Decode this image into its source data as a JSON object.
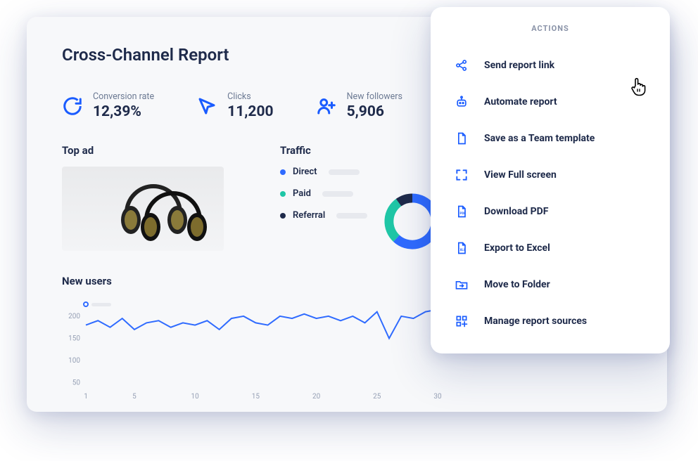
{
  "title": "Cross-Channel Report",
  "stats": {
    "conversion": {
      "label": "Conversion rate",
      "value": "12,39%"
    },
    "clicks": {
      "label": "Clicks",
      "value": "11,200"
    },
    "followers": {
      "label": "New followers",
      "value": "5,906"
    }
  },
  "top_ad": {
    "heading": "Top ad"
  },
  "traffic": {
    "heading": "Traffic",
    "items": [
      {
        "label": "Direct",
        "color": "#2f6bff"
      },
      {
        "label": "Paid",
        "color": "#1fc6a6"
      },
      {
        "label": "Referral",
        "color": "#1e2a4a"
      }
    ]
  },
  "new_users": {
    "heading": "New users"
  },
  "chart_data": {
    "type": "line",
    "title": "New users",
    "x": [
      1,
      2,
      3,
      4,
      5,
      6,
      7,
      8,
      9,
      10,
      11,
      12,
      13,
      14,
      15,
      16,
      17,
      18,
      19,
      20,
      21,
      22,
      23,
      24,
      25,
      26,
      27,
      28,
      29,
      30
    ],
    "values": [
      180,
      190,
      175,
      195,
      170,
      185,
      190,
      175,
      185,
      180,
      190,
      170,
      195,
      200,
      185,
      180,
      200,
      195,
      205,
      195,
      200,
      190,
      200,
      185,
      210,
      150,
      200,
      195,
      210,
      215
    ],
    "yticks": [
      50,
      100,
      150,
      200
    ],
    "xticks": [
      1,
      5,
      10,
      15,
      20,
      25,
      30
    ],
    "ylim": [
      40,
      230
    ],
    "xlabel": "",
    "ylabel": ""
  },
  "donut_data": {
    "type": "pie",
    "series": [
      {
        "name": "Direct",
        "value": 62,
        "color": "#2f6bff"
      },
      {
        "name": "Paid",
        "value": 28,
        "color": "#1fc6a6"
      },
      {
        "name": "Referral",
        "value": 10,
        "color": "#1e2a4a"
      }
    ]
  },
  "actions": {
    "title": "ACTIONS",
    "items": [
      {
        "label": "Send report link"
      },
      {
        "label": "Automate report"
      },
      {
        "label": "Save as a Team template"
      },
      {
        "label": "View Full screen"
      },
      {
        "label": "Download PDF"
      },
      {
        "label": "Export to Excel"
      },
      {
        "label": "Move to Folder"
      },
      {
        "label": "Manage report sources"
      }
    ]
  }
}
